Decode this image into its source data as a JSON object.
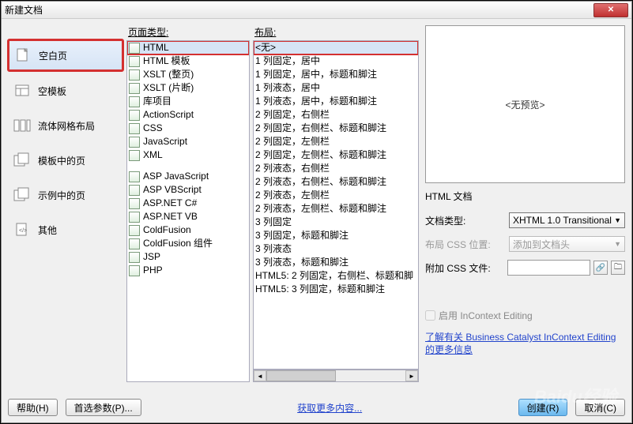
{
  "dialog": {
    "title": "新建文档",
    "close_label": "×"
  },
  "left_nav": [
    {
      "label": "空白页",
      "selected": true,
      "highlighted": true
    },
    {
      "label": "空模板"
    },
    {
      "label": "流体网格布局"
    },
    {
      "label": "模板中的页"
    },
    {
      "label": "示例中的页"
    },
    {
      "label": "其他"
    }
  ],
  "page_type": {
    "header": "页面类型:",
    "items": [
      {
        "label": "HTML",
        "selected": true,
        "highlighted": true
      },
      {
        "label": "HTML 模板"
      },
      {
        "label": "XSLT (整页)"
      },
      {
        "label": "XSLT (片断)"
      },
      {
        "label": "库项目"
      },
      {
        "label": "ActionScript"
      },
      {
        "label": "CSS"
      },
      {
        "label": "JavaScript"
      },
      {
        "label": "XML"
      },
      {
        "label": "",
        "spacer": true
      },
      {
        "label": "ASP JavaScript"
      },
      {
        "label": "ASP VBScript"
      },
      {
        "label": "ASP.NET C#"
      },
      {
        "label": "ASP.NET VB"
      },
      {
        "label": "ColdFusion"
      },
      {
        "label": "ColdFusion 组件"
      },
      {
        "label": "JSP"
      },
      {
        "label": "PHP"
      }
    ]
  },
  "layout": {
    "header": "布局:",
    "items": [
      {
        "label": "<无>",
        "selected": true,
        "highlighted": true
      },
      {
        "label": "1 列固定，居中"
      },
      {
        "label": "1 列固定，居中，标题和脚注"
      },
      {
        "label": "1 列液态，居中"
      },
      {
        "label": "1 列液态，居中，标题和脚注"
      },
      {
        "label": "2 列固定，右侧栏"
      },
      {
        "label": "2 列固定，右侧栏、标题和脚注"
      },
      {
        "label": "2 列固定，左侧栏"
      },
      {
        "label": "2 列固定，左侧栏、标题和脚注"
      },
      {
        "label": "2 列液态，右侧栏"
      },
      {
        "label": "2 列液态，右侧栏、标题和脚注"
      },
      {
        "label": "2 列液态，左侧栏"
      },
      {
        "label": "2 列液态，左侧栏、标题和脚注"
      },
      {
        "label": "3 列固定"
      },
      {
        "label": "3 列固定，标题和脚注"
      },
      {
        "label": "3 列液态"
      },
      {
        "label": "3 列液态，标题和脚注"
      },
      {
        "label": "HTML5: 2 列固定，右侧栏、标题和脚"
      },
      {
        "label": "HTML5: 3 列固定，标题和脚注"
      }
    ]
  },
  "preview": {
    "text": "<无预览>"
  },
  "right": {
    "caption": "HTML 文档",
    "doctype_label": "文档类型:",
    "doctype_value": "XHTML 1.0 Transitional",
    "layout_css_label": "布局 CSS 位置:",
    "layout_css_value": "添加到文档头",
    "attach_label": "附加 CSS 文件:",
    "enable_ice_label": "启用 InContext Editing",
    "link_text": "了解有关 Business Catalyst InContext Editing 的更多信息"
  },
  "footer": {
    "help": "帮助(H)",
    "prefs": "首选参数(P)...",
    "more": "获取更多内容...",
    "create": "创建(R)",
    "cancel": "取消(C)"
  },
  "watermark": "Baidu经验"
}
